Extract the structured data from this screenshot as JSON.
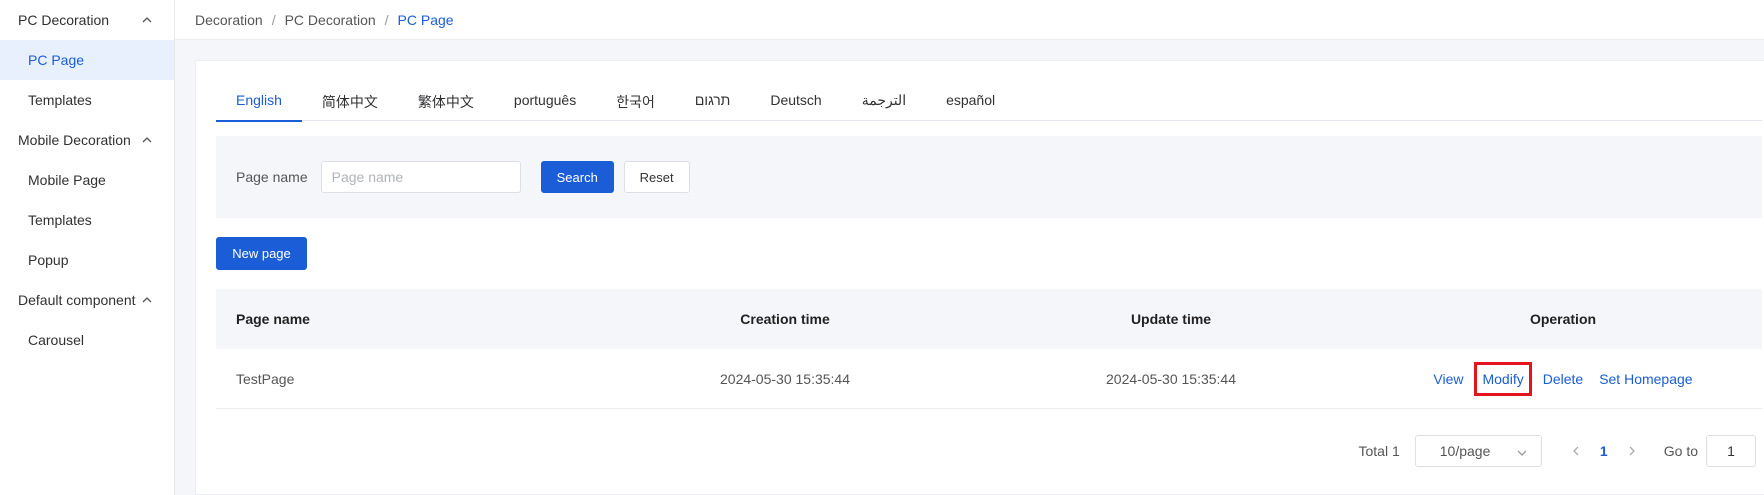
{
  "sidebar": {
    "groups": [
      {
        "title": "PC Decoration",
        "items": [
          "PC Page",
          "Templates"
        ]
      },
      {
        "title": "Mobile Decoration",
        "items": [
          "Mobile Page",
          "Templates",
          "Popup"
        ]
      },
      {
        "title": "Default component",
        "items": [
          "Carousel"
        ]
      }
    ],
    "active_item": "PC Page"
  },
  "breadcrumb": [
    "Decoration",
    "PC Decoration",
    "PC Page"
  ],
  "tabs": [
    "English",
    "简体中文",
    "繁体中文",
    "português",
    "한국어",
    "תרגום",
    "Deutsch",
    "الترجمة",
    "español"
  ],
  "active_tab": "English",
  "filter": {
    "label": "Page name",
    "placeholder": "Page name",
    "search_label": "Search",
    "reset_label": "Reset"
  },
  "new_page_label": "New page",
  "table": {
    "headers": [
      "Page name",
      "Creation time",
      "Update time",
      "Operation"
    ],
    "rows": [
      {
        "page_name": "TestPage",
        "creation_time": "2024-05-30 15:35:44",
        "update_time": "2024-05-30 15:35:44",
        "operations": [
          "View",
          "Modify",
          "Delete",
          "Set Homepage"
        ]
      }
    ]
  },
  "pagination": {
    "total": "Total 1",
    "page_size": "10/page",
    "current_page": "1",
    "goto_label": "Go to",
    "goto_value": "1"
  },
  "colors": {
    "accent": "#1a5dd6",
    "highlight_border": "#e3141e"
  }
}
